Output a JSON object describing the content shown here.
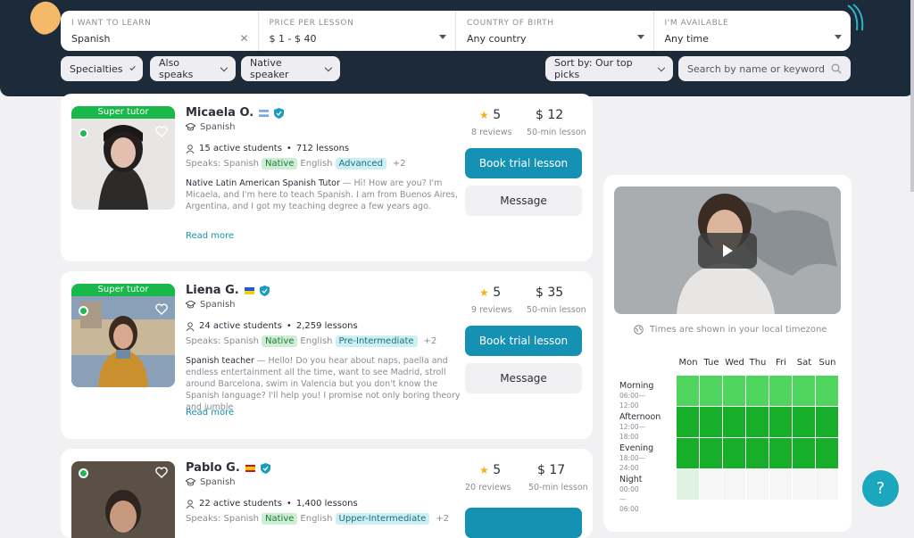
{
  "filters": {
    "learn": {
      "label": "I WANT TO LEARN",
      "value": "Spanish"
    },
    "price": {
      "label": "PRICE PER LESSON",
      "value": "$ 1 - $ 40"
    },
    "country": {
      "label": "COUNTRY OF BIRTH",
      "value": "Any country"
    },
    "available": {
      "label": "I'M AVAILABLE",
      "value": "Any time"
    }
  },
  "chips": {
    "specialties": "Specialties",
    "also_speaks": "Also speaks",
    "native": "Native speaker",
    "sort": "Sort by: Our top picks"
  },
  "search": {
    "placeholder": "Search by name or keyword"
  },
  "tutors": [
    {
      "badge": "Super tutor",
      "name": "Micaela O.",
      "subject": "Spanish",
      "students": "15 active students",
      "lessons": "712 lessons",
      "speaks": "Speaks: Spanish",
      "native": "Native",
      "lang2": "English",
      "level": "Advanced",
      "more": "+2",
      "headline": "Native Latin American Spanish Tutor",
      "desc": "— Hi! How are you? I'm Micaela, and I'm here to teach Spanish. I am from Buenos Aires, Argentina, and I got my teaching degree a few years ago.",
      "readmore": "Read more",
      "rating": "5",
      "reviews": "8 reviews",
      "price": "$ 12",
      "duration": "50-min lesson",
      "book": "Book trial lesson",
      "message": "Message"
    },
    {
      "badge": "Super tutor",
      "name": "Liena G.",
      "subject": "Spanish",
      "students": "24 active students",
      "lessons": "2,259 lessons",
      "speaks": "Speaks: Spanish",
      "native": "Native",
      "lang2": "English",
      "level": "Pre-Intermediate",
      "more": "+2",
      "headline": "Spanish teacher",
      "desc": "— Hello! Do you hear about naps, paella and endless entertainment all the time, want to see Madrid, stroll around Barcelona, swim in Valencia but you don't know the Spanish language? I'll help you! I promise not only boring theory and jumble",
      "readmore": "Read more",
      "rating": "5",
      "reviews": "9 reviews",
      "price": "$ 35",
      "duration": "50-min lesson",
      "book": "Book trial lesson",
      "message": "Message"
    },
    {
      "badge": "",
      "name": "Pablo G.",
      "subject": "Spanish",
      "students": "22 active students",
      "lessons": "1,400 lessons",
      "speaks": "Speaks: Spanish",
      "native": "Native",
      "lang2": "English",
      "level": "Upper-Intermediate",
      "more": "+2",
      "headline": "",
      "desc": "",
      "readmore": "",
      "rating": "5",
      "reviews": "20 reviews",
      "price": "$ 17",
      "duration": "50-min lesson",
      "book": "",
      "message": ""
    }
  ],
  "schedule": {
    "timezone": "Times are shown in your local timezone",
    "days": [
      "Mon",
      "Tue",
      "Wed",
      "Thu",
      "Fri",
      "Sat",
      "Sun"
    ],
    "slots": [
      {
        "name": "Morning",
        "range": "06:00—12:00"
      },
      {
        "name": "Afternoon",
        "range": "12:00—18:00"
      },
      {
        "name": "Evening",
        "range": "18:00—24:00"
      },
      {
        "name": "Night",
        "range": "00:00—06:00"
      }
    ],
    "availability_levels": [
      [
        0.7,
        0.7,
        0.7,
        0.7,
        0.7,
        0.7,
        0.7
      ],
      [
        1,
        1,
        1,
        1,
        1,
        1,
        1
      ],
      [
        1,
        1,
        1,
        1,
        1,
        1,
        1
      ],
      [
        0.15,
        0,
        0,
        0,
        0,
        0,
        0
      ]
    ],
    "colors": {
      "high": "#17ae2a",
      "medium": "#4fd55e",
      "low": "#e0f3e2",
      "none": "#f6f6f6"
    }
  },
  "help": "?"
}
